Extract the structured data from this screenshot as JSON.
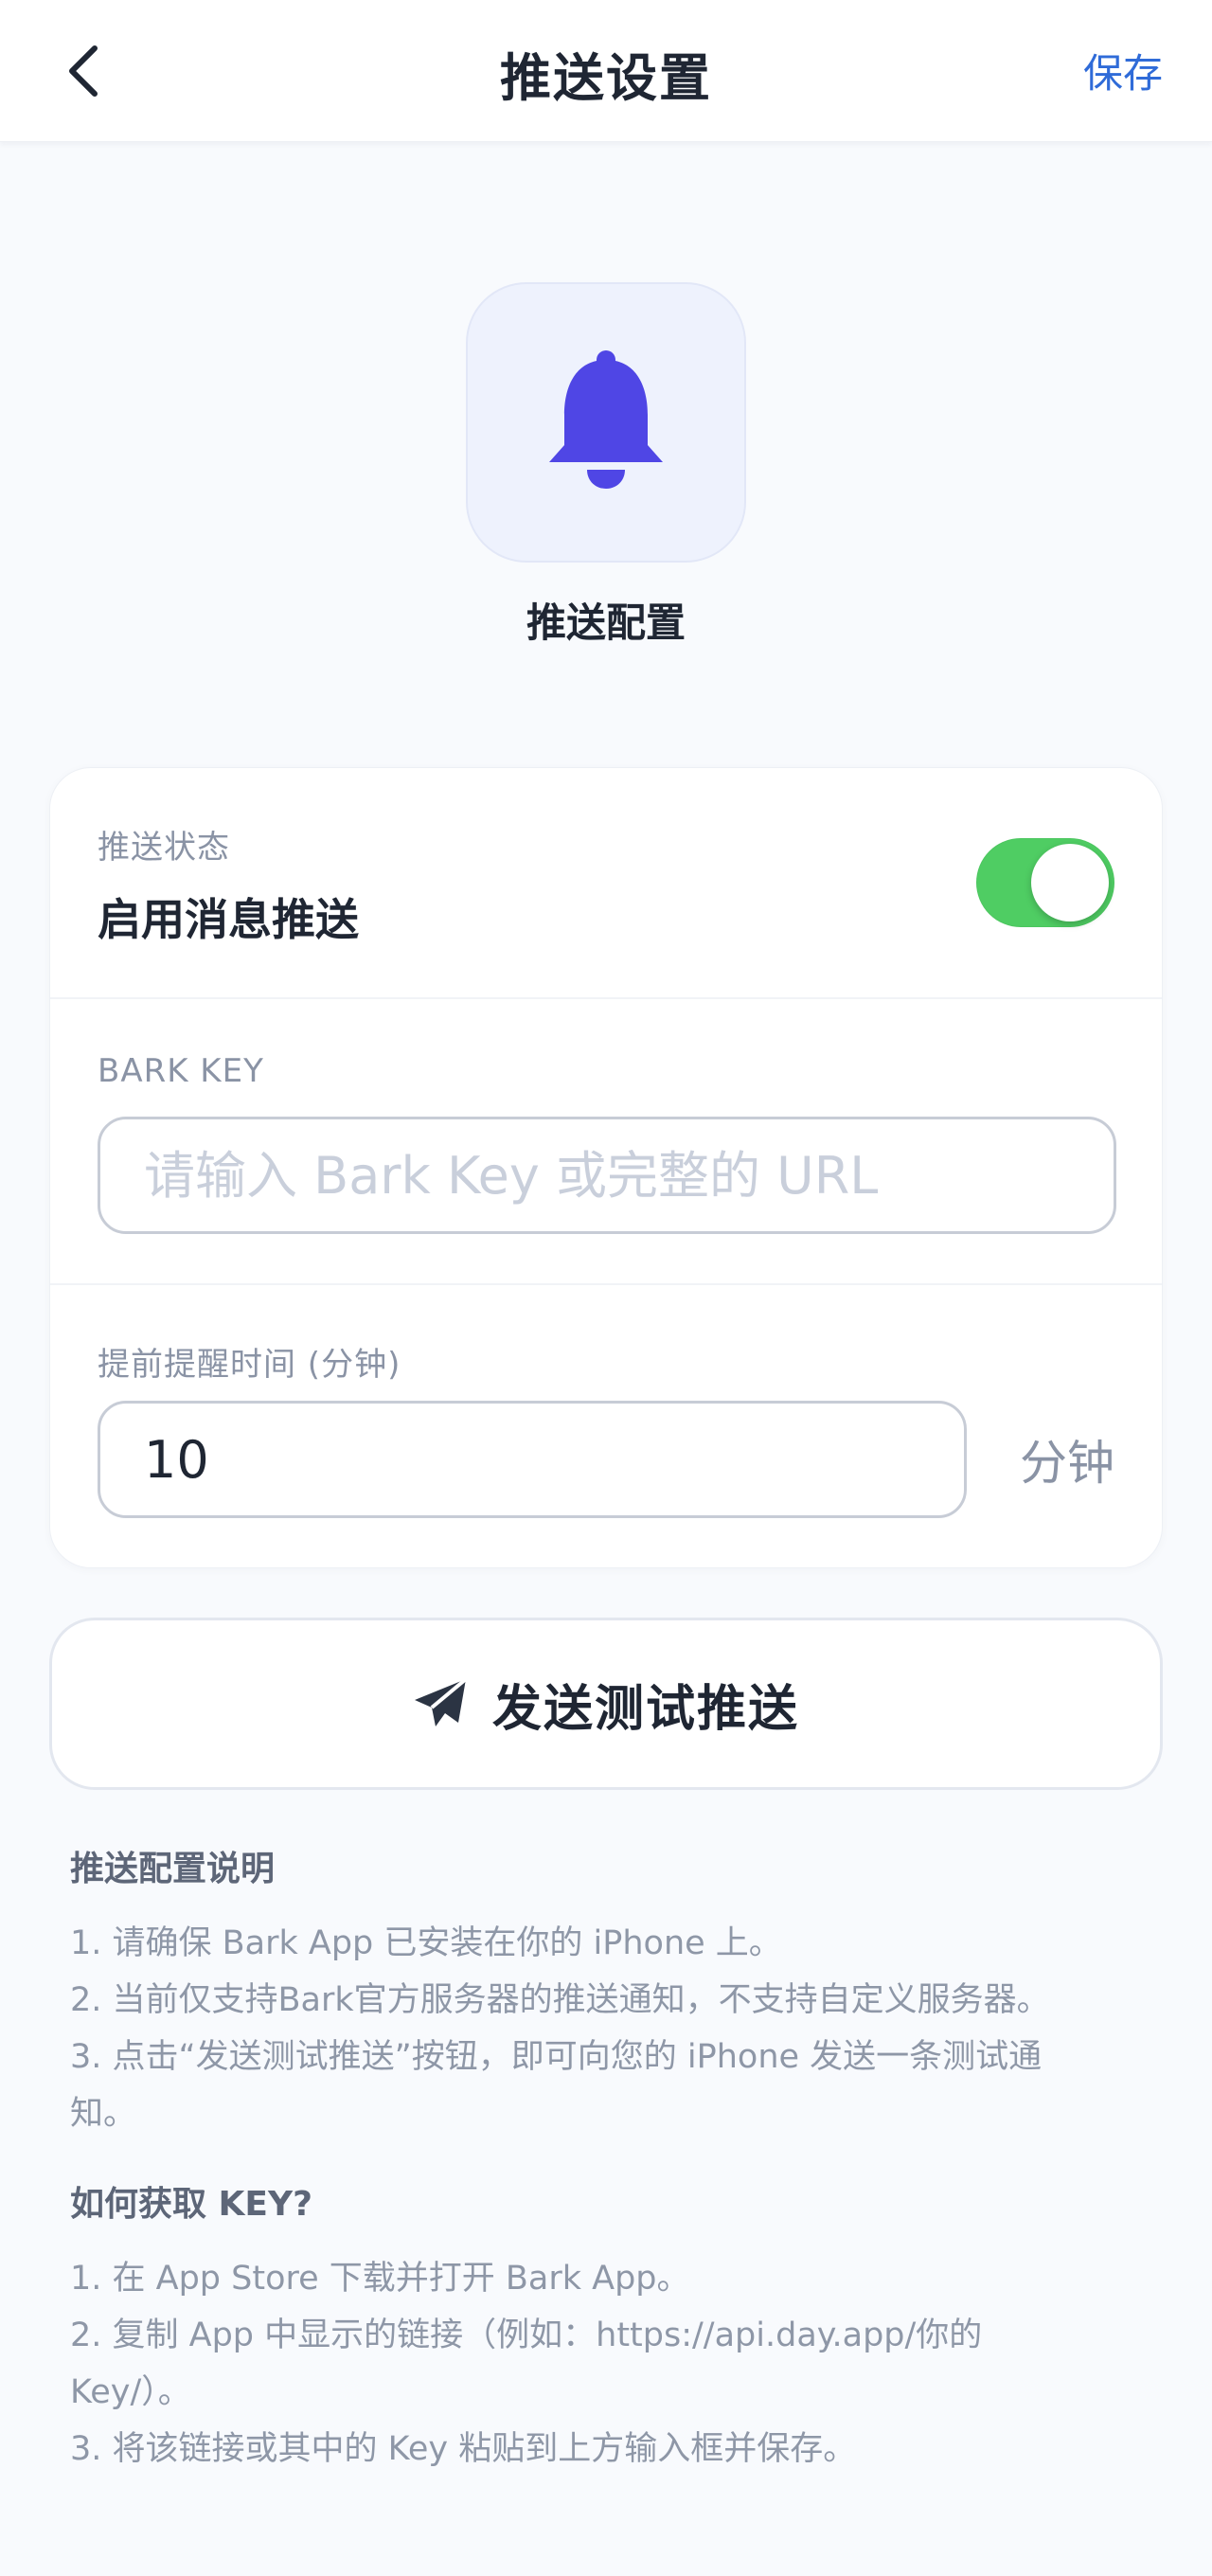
{
  "header": {
    "title": "推送设置",
    "save_label": "保存"
  },
  "hero": {
    "label": "推送配置",
    "accent_color": "#4f46e5"
  },
  "push_status": {
    "small_label": "推送状态",
    "title": "启用消息推送",
    "enabled": true,
    "toggle_color": "#4fcd63"
  },
  "bark_key": {
    "label": "BARK KEY",
    "value": "",
    "placeholder": "请输入 Bark Key 或完整的 URL"
  },
  "reminder": {
    "label": "提前提醒时间 (分钟)",
    "value": "10",
    "unit": "分钟"
  },
  "test_button": {
    "label": "发送测试推送"
  },
  "help_config": {
    "title": "推送配置说明",
    "lines": [
      "1. 请确保 Bark App 已安装在你的 iPhone 上。",
      "2. 当前仅支持Bark官方服务器的推送通知，不支持自定义服务器。",
      "3. 点击“发送测试推送”按钮，即可向您的 iPhone 发送一条测试通",
      "知。"
    ]
  },
  "help_key": {
    "title": "如何获取 KEY?",
    "lines": [
      "1. 在 App Store 下载并打开 Bark App。",
      "2. 复制 App 中显示的链接（例如：https://api.day.app/你的",
      "Key/）。",
      "3. 将该链接或其中的 Key 粘贴到上方输入框并保存。"
    ]
  },
  "icons": {
    "back": "chevron-left-icon",
    "hero": "bell-icon",
    "test": "paper-plane-icon"
  }
}
